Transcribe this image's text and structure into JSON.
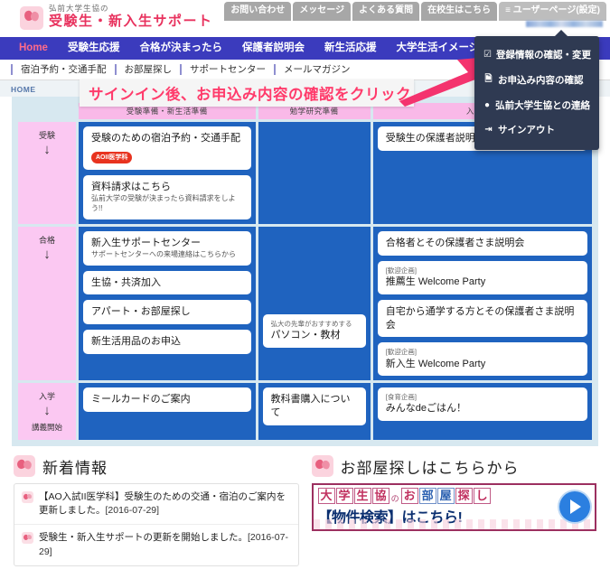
{
  "header": {
    "brand_sub": "弘前大学生協の",
    "brand_main": "受験生・新入生サポート",
    "logo_icon": "tulip-logo-icon",
    "top_buttons": [
      {
        "label": "お問い合わせ",
        "name": "contact"
      },
      {
        "label": "メッセージ",
        "name": "message"
      },
      {
        "label": "よくある質問",
        "name": "faq"
      },
      {
        "label": "在校生はこちら",
        "name": "current-students"
      },
      {
        "label": "≡ ユーザーページ(設定)",
        "name": "user-page-settings"
      }
    ]
  },
  "dropdown": {
    "items": [
      {
        "icon": "☑",
        "label": "登録情報の確認・変更",
        "name": "registration-info"
      },
      {
        "icon": "🗎",
        "label": "お申込み内容の確認",
        "name": "application-confirm"
      },
      {
        "icon": "●",
        "label": "弘前大学生協との連絡",
        "name": "contact-coop"
      },
      {
        "icon": "⇥",
        "label": "サインアウト",
        "name": "sign-out"
      }
    ]
  },
  "mainnav": {
    "items": [
      {
        "label": "Home",
        "active": true
      },
      {
        "label": "受験生応援",
        "active": false
      },
      {
        "label": "合格が決まったら",
        "active": false
      },
      {
        "label": "保護者説明会",
        "active": false
      },
      {
        "label": "新生活応援",
        "active": false
      },
      {
        "label": "大学生活イメージ",
        "active": false
      }
    ]
  },
  "subnav": {
    "items": [
      "宿泊予約・交通手配",
      "お部屋探し",
      "サポートセンター",
      "メールマガジン"
    ]
  },
  "breadcrumb": {
    "text": "HOME"
  },
  "annotation": {
    "text": "サインイン後、お申込み内容の確認をクリック",
    "color": "#ff3b6b",
    "arrow_name": "pointer-arrow-icon"
  },
  "grid": {
    "column_headers": [
      "受験準備・新生活準備",
      "勉学研究準備",
      "入学準備"
    ],
    "rows": [
      {
        "stage": "受験",
        "arrow": "↓",
        "stage_sub": "",
        "col1": [
          {
            "title": "受験のための宿泊予約・交通手配",
            "badge": "AOII医学科"
          },
          {
            "title": "資料請求はこちら",
            "sub": "弘前大学の受験が決まったら資料請求をしよう!!"
          }
        ],
        "col2": [],
        "col3": [
          {
            "title": "受験生の保護者説明会"
          }
        ]
      },
      {
        "stage": "合格",
        "arrow": "↓",
        "stage_sub": "",
        "col1": [
          {
            "title": "新入生サポートセンター",
            "sub": "サポートセンターへの来場連絡はこちらから"
          },
          {
            "title": "生協・共済加入"
          },
          {
            "title": "アパート・お部屋探し"
          },
          {
            "title": "新生活用品のお申込"
          }
        ],
        "col2": [
          {
            "label": "弘大の先輩がおすすめする",
            "title": "パソコン・教材"
          }
        ],
        "col3": [
          {
            "title": "合格者とその保護者さま説明会"
          },
          {
            "label": "[歓迎企画]",
            "title": "推薦生 Welcome Party"
          },
          {
            "title": "自宅から通学する方とその保護者さま説明会"
          },
          {
            "label": "[歓迎企画]",
            "title": "新入生 Welcome Party"
          }
        ]
      },
      {
        "stage": "入学",
        "arrow": "↓",
        "stage_sub": "講義開始",
        "col1": [
          {
            "title": "ミールカードのご案内"
          }
        ],
        "col2": [
          {
            "title": "教科書購入について"
          }
        ],
        "col3": [
          {
            "label": "[食育企画]",
            "title": "みんなdeごはん！"
          }
        ]
      }
    ]
  },
  "news": {
    "title": "新着情報",
    "items": [
      {
        "text": "【AO入試II医学科】受験生のための交通・宿泊のご案内を更新しました。",
        "date": "[2016-07-29]"
      },
      {
        "text": "受験生・新入生サポートの更新を開始しました。",
        "date": "[2016-07-29]"
      }
    ]
  },
  "room": {
    "title": "お部屋探しはこちらから",
    "banner": {
      "line1_boxes": [
        "大",
        "学",
        "生",
        "協"
      ],
      "line1_no": "の",
      "line1_boxes2": [
        "お",
        "部",
        "屋",
        "探",
        "し"
      ],
      "line2": "【物件検索】はこちら!",
      "play_icon": "play-button-icon"
    }
  },
  "colors": {
    "nav_blue": "#3b3bbd",
    "grid_blue": "#1f63bf",
    "pink": "#fbc8f2",
    "header_pink": "#f9b9e8",
    "accent_red": "#e8325e",
    "annotation": "#ff3b6b",
    "dropdown_bg": "#2f3a52"
  }
}
